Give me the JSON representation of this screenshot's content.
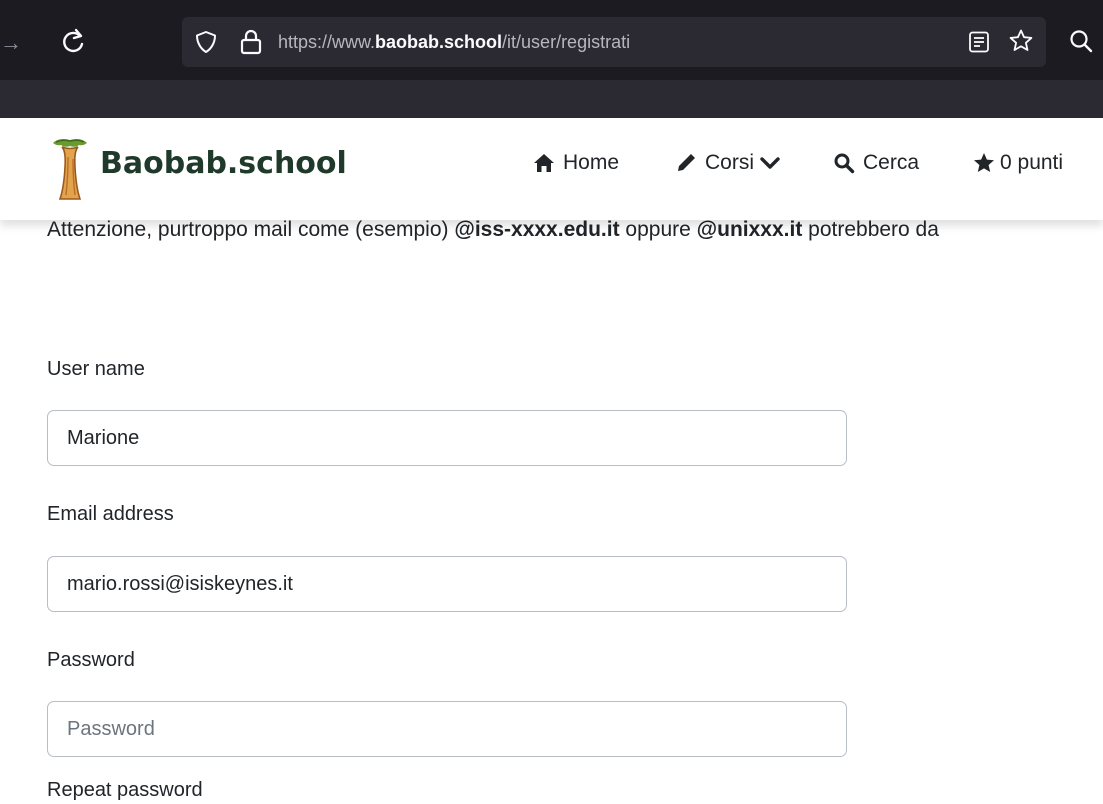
{
  "browser": {
    "url_prefix": "https://www.",
    "url_domain": "baobab.school",
    "url_path": "/it/user/registrati"
  },
  "header": {
    "brand": "Baobab.school",
    "nav": {
      "home": "Home",
      "corsi": "Corsi",
      "cerca": "Cerca",
      "punti": "0 punti"
    }
  },
  "notice": {
    "text_1": "Attenzione, purtroppo mail come (esempio) ",
    "bold_1": "@iss-xxxx.edu.it",
    "text_2": " oppure ",
    "bold_2": "@unixxx.it",
    "text_3": " potrebbero da"
  },
  "form": {
    "username_label": "User name",
    "username_value": "Marione",
    "email_label": "Email address",
    "email_value": "mario.rossi@isiskeynes.it",
    "password_label": "Password",
    "password_placeholder": "Password",
    "repeat_password_label": "Repeat password"
  },
  "colors": {
    "chrome_bg": "#1c1b22",
    "urlbar_bg": "#2b2a33",
    "brand_text": "#1f3a2a",
    "text": "#212529",
    "input_border": "#b9bec4"
  },
  "icons": [
    "forward-icon",
    "reload-icon",
    "shield-icon",
    "lock-icon",
    "reader-view-icon",
    "bookmark-star-icon",
    "search-icon",
    "baobab-tree-logo",
    "home-icon",
    "pencil-icon",
    "chevron-down-icon",
    "magnifier-icon",
    "star-icon"
  ]
}
